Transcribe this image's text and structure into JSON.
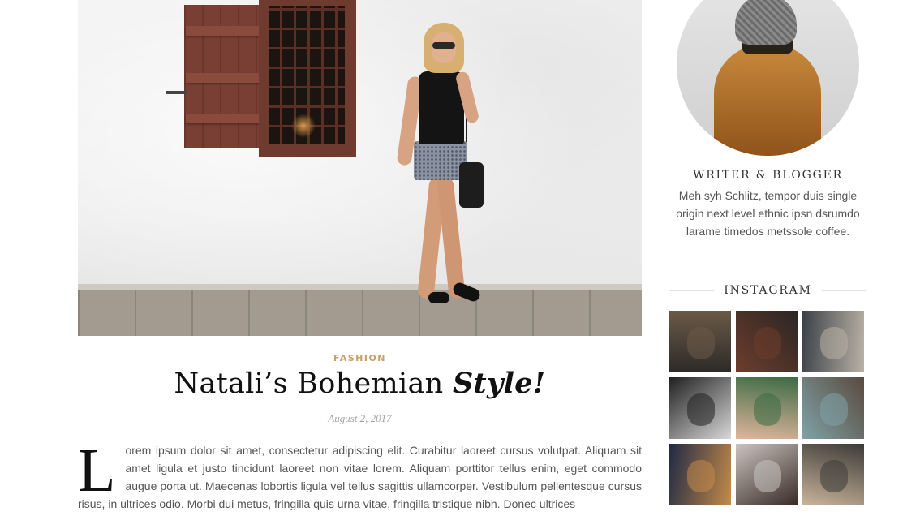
{
  "post": {
    "category": "FASHION",
    "title_main": "Natali’s Bohemian",
    "title_emphasis": "Style!",
    "date": "August 2, 2017",
    "dropcap": "L",
    "body": "orem ipsum dolor sit amet, consectetur adipiscing elit. Curabitur laoreet cursus volutpat. Aliquam sit amet ligula et justo tincidunt laoreet non vitae lorem. Aliquam porttitor tellus enim, eget commodo augue porta ut. Maecenas lobortis ligula vel tellus sagittis ullamcorper. Vestibulum pellentesque cursus risus, in ultrices odio. Morbi dui metus, fringilla quis urna vitae, fringilla tristique nibh. Donec ultrices"
  },
  "sidebar": {
    "about_title": "WRITER & BLOGGER",
    "about_text": "Meh syh Schlitz, tempor duis single origin next level ethnic ipsn dsrumdo larame timedos metssole coffee.",
    "instagram_title": "INSTAGRAM",
    "instagram_photos": [
      {
        "name": "dog",
        "colors": [
          "#2c2a28",
          "#6b5a48"
        ]
      },
      {
        "name": "woman-brick-wall",
        "colors": [
          "#6e3d2c",
          "#2a2624"
        ]
      },
      {
        "name": "train-station",
        "colors": [
          "#3c4148",
          "#b9b2a6"
        ]
      },
      {
        "name": "laptop-notebook",
        "colors": [
          "#202020",
          "#d8d8d8"
        ]
      },
      {
        "name": "hands-succulent",
        "colors": [
          "#e0b59c",
          "#3b6b44"
        ]
      },
      {
        "name": "camera-hands",
        "colors": [
          "#7fa2a8",
          "#5a4a3e"
        ]
      },
      {
        "name": "city-night",
        "colors": [
          "#1f2a44",
          "#c58a4a"
        ]
      },
      {
        "name": "mother-child",
        "colors": [
          "#c9c4bf",
          "#3a2a26"
        ]
      },
      {
        "name": "bridge-walkway",
        "colors": [
          "#c9b59a",
          "#3c3a38"
        ]
      }
    ]
  }
}
